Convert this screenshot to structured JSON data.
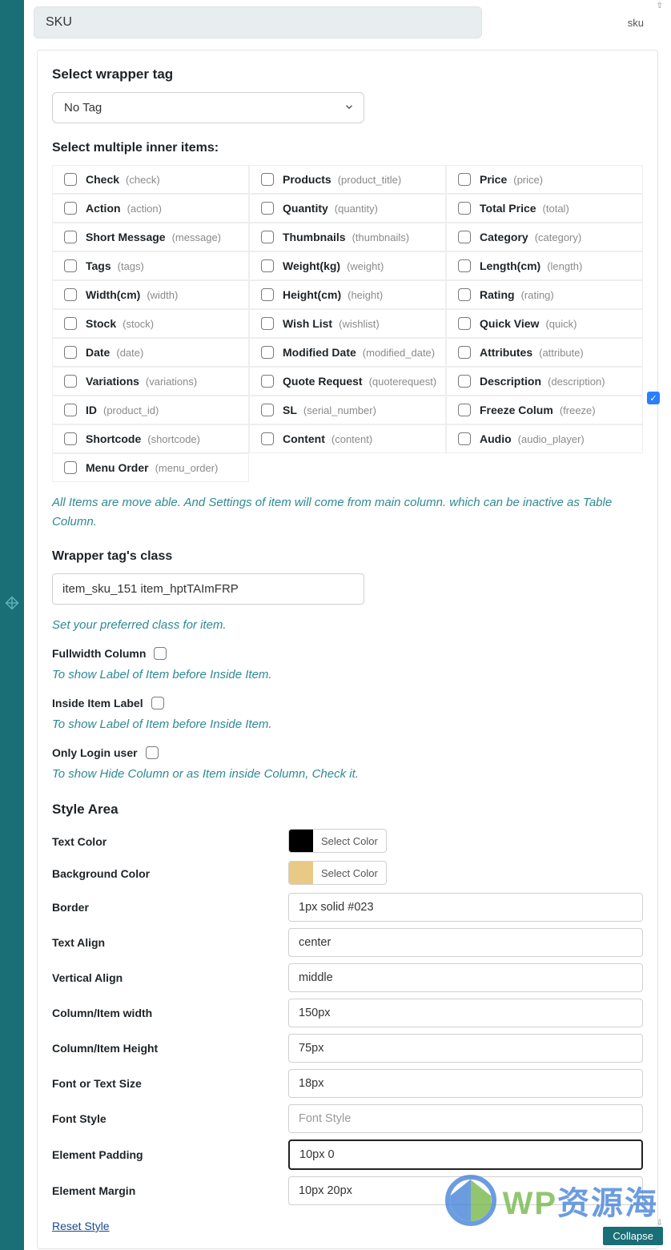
{
  "header": {
    "title_value": "SKU",
    "slug": "sku"
  },
  "wrapper": {
    "heading": "Select wrapper tag",
    "option": "No Tag"
  },
  "inner": {
    "heading": "Select multiple inner items:",
    "col1": [
      {
        "label": "Check",
        "code": "(check)"
      },
      {
        "label": "Action",
        "code": "(action)"
      },
      {
        "label": "Short Message",
        "code": "(message)"
      },
      {
        "label": "Tags",
        "code": "(tags)"
      },
      {
        "label": "Width(cm)",
        "code": "(width)"
      },
      {
        "label": "Stock",
        "code": "(stock)"
      },
      {
        "label": "Date",
        "code": "(date)"
      },
      {
        "label": "Variations",
        "code": "(variations)"
      },
      {
        "label": "ID",
        "code": "(product_id)"
      },
      {
        "label": "Shortcode",
        "code": "(shortcode)"
      },
      {
        "label": "Menu Order",
        "code": "(menu_order)"
      }
    ],
    "col2": [
      {
        "label": "Products",
        "code": "(product_title)"
      },
      {
        "label": "Quantity",
        "code": "(quantity)"
      },
      {
        "label": "Thumbnails",
        "code": "(thumbnails)"
      },
      {
        "label": "Weight(kg)",
        "code": "(weight)"
      },
      {
        "label": "Height(cm)",
        "code": "(height)"
      },
      {
        "label": "Wish List",
        "code": "(wishlist)"
      },
      {
        "label": "Modified Date",
        "code": "(modified_date)"
      },
      {
        "label": "Quote Request",
        "code": "(quoterequest)"
      },
      {
        "label": "SL",
        "code": "(serial_number)"
      },
      {
        "label": "Content",
        "code": "(content)"
      }
    ],
    "col3": [
      {
        "label": "Price",
        "code": "(price)"
      },
      {
        "label": "Total Price",
        "code": "(total)"
      },
      {
        "label": "Category",
        "code": "(category)"
      },
      {
        "label": "Length(cm)",
        "code": "(length)"
      },
      {
        "label": "Rating",
        "code": "(rating)"
      },
      {
        "label": "Quick View",
        "code": "(quick)"
      },
      {
        "label": "Attributes",
        "code": "(attribute)"
      },
      {
        "label": "Description",
        "code": "(description)"
      },
      {
        "label": "Freeze Colum",
        "code": "(freeze)"
      },
      {
        "label": "Audio",
        "code": "(audio_player)"
      }
    ],
    "hint": "All Items are move able. And Settings of item will come from main column. which can be inactive as Table Column."
  },
  "wrapperClass": {
    "heading": "Wrapper tag's class",
    "value": "item_sku_151 item_hptTAImFRP",
    "hint": "Set your preferred class for item."
  },
  "checks": {
    "fullwidth_label": "Fullwidth Column",
    "fullwidth_hint": "To show Label of Item before Inside Item.",
    "inside_label": "Inside Item Label",
    "inside_hint": "To show Label of Item before Inside Item.",
    "login_label": "Only Login user",
    "login_hint": "To show Hide Column or as Item inside Column, Check it."
  },
  "style": {
    "heading": "Style Area",
    "select_color": "Select Color",
    "rows": {
      "text_color": "Text Color",
      "bg_color": "Background Color",
      "border": {
        "label": "Border",
        "value": "1px solid #023"
      },
      "text_align": {
        "label": "Text Align",
        "value": "center"
      },
      "valign": {
        "label": "Vertical Align",
        "value": "middle"
      },
      "width": {
        "label": "Column/Item width",
        "value": "150px"
      },
      "height": {
        "label": "Column/Item Height",
        "value": "75px"
      },
      "fontsize": {
        "label": "Font or Text Size",
        "value": "18px"
      },
      "fontstyle": {
        "label": "Font Style",
        "placeholder": "Font Style"
      },
      "padding": {
        "label": "Element Padding",
        "value": "10px 0"
      },
      "margin": {
        "label": "Element Margin",
        "value": "10px 20px"
      }
    },
    "reset": "Reset Style"
  },
  "collapse": "Collapse",
  "watermark": {
    "a": "WP",
    "b": "资源海"
  }
}
